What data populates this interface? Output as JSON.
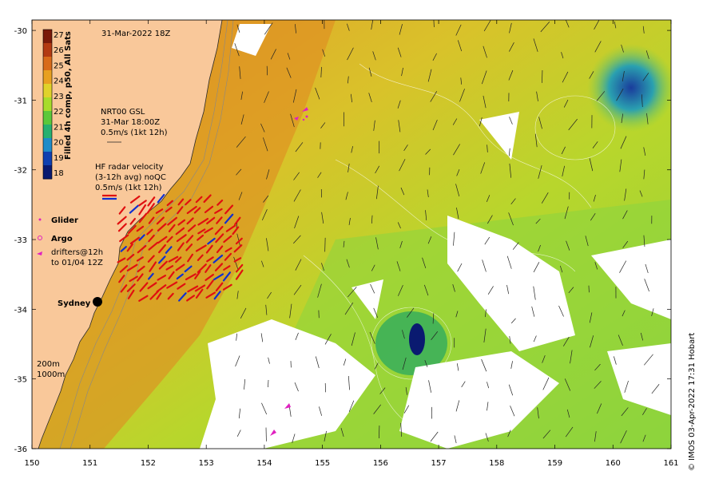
{
  "map": {
    "title": "31-Mar-2022 18Z",
    "credit": "© IMOS 03-Apr-2022 17:31 Hobart",
    "lon_ticks": [
      "150",
      "151",
      "152",
      "153",
      "154",
      "155",
      "156",
      "157",
      "158",
      "159",
      "160",
      "161"
    ],
    "lat_ticks": [
      "-30",
      "-31",
      "-32",
      "-33",
      "-34",
      "-35",
      "-36"
    ],
    "lon_range": [
      150,
      161
    ],
    "lat_range": [
      -36,
      -29.85
    ],
    "colorbar": {
      "title": "Filled 4h comp, p50, All Sats",
      "ticks": [
        "27",
        "26",
        "25",
        "24",
        "23",
        "22",
        "21",
        "20",
        "19",
        "18"
      ],
      "colors": [
        "#7a1a0a",
        "#b33a12",
        "#d86a1a",
        "#e8a020",
        "#e0d22a",
        "#a8dc2a",
        "#5cc83a",
        "#28b070",
        "#1e8cc8",
        "#1040b0",
        "#0a1a70"
      ]
    },
    "gsl": {
      "line1": "NRT00 GSL",
      "line2": "31-Mar 18:00Z",
      "line3": "0.5m/s (1kt 12h)"
    },
    "hf": {
      "line1": "HF radar velocity",
      "line2": "(3-12h avg) noQC",
      "line3": "0.5m/s (1kt 12h)"
    },
    "legend": {
      "glider": "Glider",
      "argo": "Argo",
      "drifters1": "drifters@12h",
      "drifters2": "to 01/04 12Z"
    },
    "city": "Sydney",
    "iso1": "200m",
    "iso2": "1000m",
    "colors": {
      "land": "#f9c89a",
      "coast": "#2a2a2a",
      "hf_vector": "#e01010",
      "hf_vector_blue": "#1030d0",
      "drifter": "#e020c0",
      "argo": "#e020c0",
      "glider": "#e020c0"
    }
  }
}
